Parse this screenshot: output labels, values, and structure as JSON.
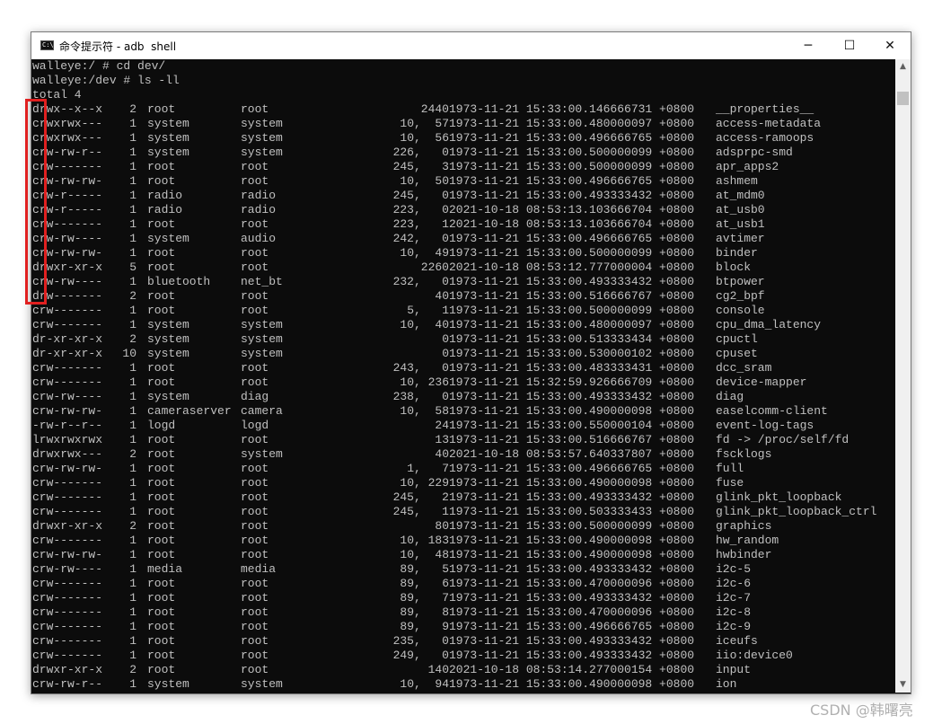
{
  "window": {
    "title": "命令提示符 - adb  shell",
    "icon_text": "C:\\",
    "minimize": "─",
    "maximize": "☐",
    "close": "✕"
  },
  "scrollbar": {
    "up": "▲",
    "down": "▼"
  },
  "terminal": {
    "lines": [
      "walleye:/ # cd dev/",
      "walleye:/dev # ls -ll",
      "total 4"
    ],
    "rows": [
      [
        "drwx--x--x",
        "2",
        "root",
        "root",
        "2440",
        "1973-11-21 15:33:00.146666731 +0800",
        "__properties__"
      ],
      [
        "crwxrwx---",
        "1",
        "system",
        "system",
        "10,  57",
        "1973-11-21 15:33:00.480000097 +0800",
        "access-metadata"
      ],
      [
        "crwxrwx---",
        "1",
        "system",
        "system",
        "10,  56",
        "1973-11-21 15:33:00.496666765 +0800",
        "access-ramoops"
      ],
      [
        "crw-rw-r--",
        "1",
        "system",
        "system",
        "226,   0",
        "1973-11-21 15:33:00.500000099 +0800",
        "adsprpc-smd"
      ],
      [
        "crw-------",
        "1",
        "root",
        "root",
        "245,   3",
        "1973-11-21 15:33:00.500000099 +0800",
        "apr_apps2"
      ],
      [
        "crw-rw-rw-",
        "1",
        "root",
        "root",
        "10,  50",
        "1973-11-21 15:33:00.496666765 +0800",
        "ashmem"
      ],
      [
        "crw-r-----",
        "1",
        "radio",
        "radio",
        "245,   0",
        "1973-11-21 15:33:00.493333432 +0800",
        "at_mdm0"
      ],
      [
        "crw-r-----",
        "1",
        "radio",
        "radio",
        "223,   0",
        "2021-10-18 08:53:13.103666704 +0800",
        "at_usb0"
      ],
      [
        "crw-------",
        "1",
        "root",
        "root",
        "223,   1",
        "2021-10-18 08:53:13.103666704 +0800",
        "at_usb1"
      ],
      [
        "crw-rw----",
        "1",
        "system",
        "audio",
        "242,   0",
        "1973-11-21 15:33:00.496666765 +0800",
        "avtimer"
      ],
      [
        "crw-rw-rw-",
        "1",
        "root",
        "root",
        "10,  49",
        "1973-11-21 15:33:00.500000099 +0800",
        "binder"
      ],
      [
        "drwxr-xr-x",
        "5",
        "root",
        "root",
        "2260",
        "2021-10-18 08:53:12.777000004 +0800",
        "block"
      ],
      [
        "crw-rw----",
        "1",
        "bluetooth",
        "net_bt",
        "232,   0",
        "1973-11-21 15:33:00.493333432 +0800",
        "btpower"
      ],
      [
        "drw-------",
        "2",
        "root",
        "root",
        "40",
        "1973-11-21 15:33:00.516666767 +0800",
        "cg2_bpf"
      ],
      [
        "crw-------",
        "1",
        "root",
        "root",
        "5,   1",
        "1973-11-21 15:33:00.500000099 +0800",
        "console"
      ],
      [
        "crw-------",
        "1",
        "system",
        "system",
        "10,  40",
        "1973-11-21 15:33:00.480000097 +0800",
        "cpu_dma_latency"
      ],
      [
        "dr-xr-xr-x",
        "2",
        "system",
        "system",
        "0",
        "1973-11-21 15:33:00.513333434 +0800",
        "cpuctl"
      ],
      [
        "dr-xr-xr-x",
        "10",
        "system",
        "system",
        "0",
        "1973-11-21 15:33:00.530000102 +0800",
        "cpuset"
      ],
      [
        "crw-------",
        "1",
        "root",
        "root",
        "243,   0",
        "1973-11-21 15:33:00.483333431 +0800",
        "dcc_sram"
      ],
      [
        "crw-------",
        "1",
        "root",
        "root",
        "10, 236",
        "1973-11-21 15:32:59.926666709 +0800",
        "device-mapper"
      ],
      [
        "crw-rw----",
        "1",
        "system",
        "diag",
        "238,   0",
        "1973-11-21 15:33:00.493333432 +0800",
        "diag"
      ],
      [
        "crw-rw-rw-",
        "1",
        "cameraserver",
        "camera",
        "10,  58",
        "1973-11-21 15:33:00.490000098 +0800",
        "easelcomm-client"
      ],
      [
        "-rw-r--r--",
        "1",
        "logd",
        "logd",
        "24",
        "1973-11-21 15:33:00.550000104 +0800",
        "event-log-tags"
      ],
      [
        "lrwxrwxrwx",
        "1",
        "root",
        "root",
        "13",
        "1973-11-21 15:33:00.516666767 +0800",
        "fd -> /proc/self/fd"
      ],
      [
        "drwxrwx---",
        "2",
        "root",
        "system",
        "40",
        "2021-10-18 08:53:57.640337807 +0800",
        "fscklogs"
      ],
      [
        "crw-rw-rw-",
        "1",
        "root",
        "root",
        "1,   7",
        "1973-11-21 15:33:00.496666765 +0800",
        "full"
      ],
      [
        "crw-------",
        "1",
        "root",
        "root",
        "10, 229",
        "1973-11-21 15:33:00.490000098 +0800",
        "fuse"
      ],
      [
        "crw-------",
        "1",
        "root",
        "root",
        "245,   2",
        "1973-11-21 15:33:00.493333432 +0800",
        "glink_pkt_loopback"
      ],
      [
        "crw-------",
        "1",
        "root",
        "root",
        "245,   1",
        "1973-11-21 15:33:00.503333433 +0800",
        "glink_pkt_loopback_ctrl"
      ],
      [
        "drwxr-xr-x",
        "2",
        "root",
        "root",
        "80",
        "1973-11-21 15:33:00.500000099 +0800",
        "graphics"
      ],
      [
        "crw-------",
        "1",
        "root",
        "root",
        "10, 183",
        "1973-11-21 15:33:00.490000098 +0800",
        "hw_random"
      ],
      [
        "crw-rw-rw-",
        "1",
        "root",
        "root",
        "10,  48",
        "1973-11-21 15:33:00.490000098 +0800",
        "hwbinder"
      ],
      [
        "crw-rw----",
        "1",
        "media",
        "media",
        "89,   5",
        "1973-11-21 15:33:00.493333432 +0800",
        "i2c-5"
      ],
      [
        "crw-------",
        "1",
        "root",
        "root",
        "89,   6",
        "1973-11-21 15:33:00.470000096 +0800",
        "i2c-6"
      ],
      [
        "crw-------",
        "1",
        "root",
        "root",
        "89,   7",
        "1973-11-21 15:33:00.493333432 +0800",
        "i2c-7"
      ],
      [
        "crw-------",
        "1",
        "root",
        "root",
        "89,   8",
        "1973-11-21 15:33:00.470000096 +0800",
        "i2c-8"
      ],
      [
        "crw-------",
        "1",
        "root",
        "root",
        "89,   9",
        "1973-11-21 15:33:00.496666765 +0800",
        "i2c-9"
      ],
      [
        "crw-------",
        "1",
        "root",
        "root",
        "235,   0",
        "1973-11-21 15:33:00.493333432 +0800",
        "iceufs"
      ],
      [
        "crw-------",
        "1",
        "root",
        "root",
        "249,   0",
        "1973-11-21 15:33:00.493333432 +0800",
        "iio:device0"
      ],
      [
        "drwxr-xr-x",
        "2",
        "root",
        "root",
        "140",
        "2021-10-18 08:53:14.277000154 +0800",
        "input"
      ],
      [
        "crw-rw-r--",
        "1",
        "system",
        "system",
        "10,  94",
        "1973-11-21 15:33:00.490000098 +0800",
        "ion"
      ]
    ]
  },
  "watermark": "CSDN @韩曙亮",
  "colors": {
    "terminal_bg": "#0c0c0c",
    "terminal_fg": "#c0c0c0",
    "highlight": "#e02020"
  }
}
